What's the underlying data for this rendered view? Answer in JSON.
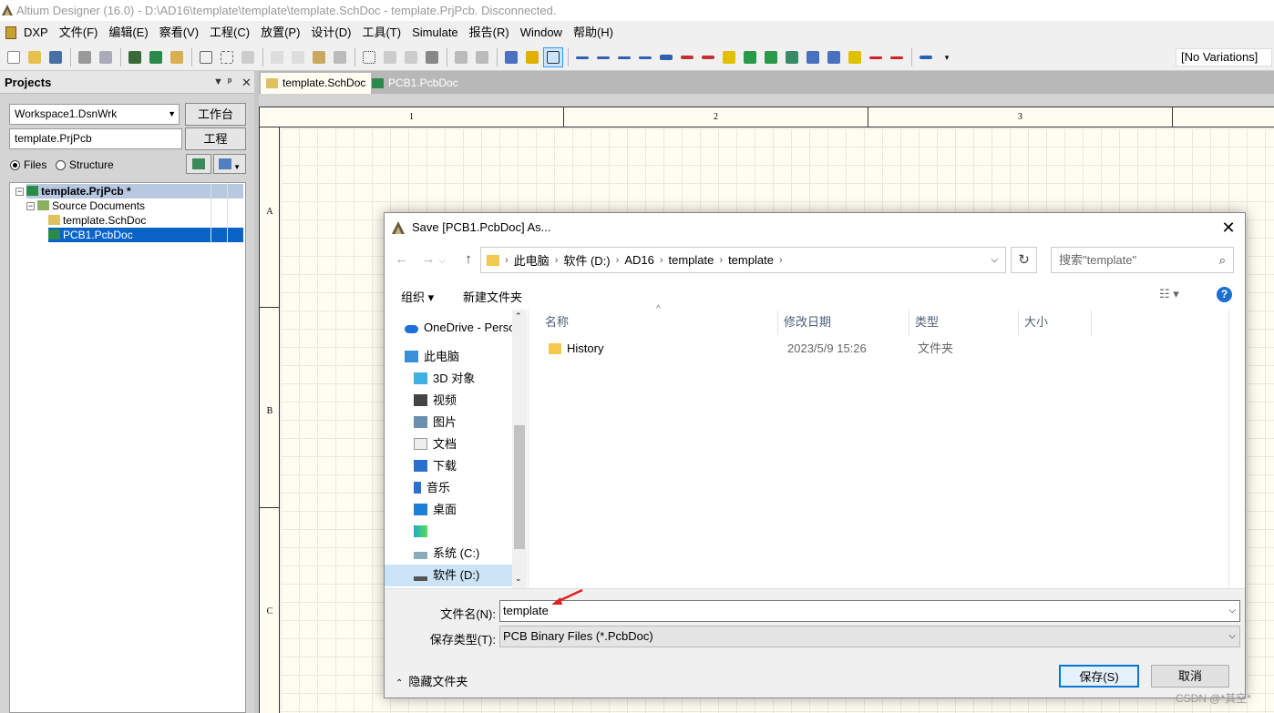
{
  "window": {
    "title": "Altium Designer (16.0) - D:\\AD16\\template\\template\\template.SchDoc - template.PrjPcb. Disconnected."
  },
  "menu": [
    "DXP",
    "文件(F)",
    "编辑(E)",
    "察看(V)",
    "工程(C)",
    "放置(P)",
    "设计(D)",
    "工具(T)",
    "Simulate",
    "报告(R)",
    "Window",
    "帮助(H)"
  ],
  "toolbar": {
    "variations": "[No Variations]"
  },
  "projects": {
    "title": "Projects",
    "workspace": "Workspace1.DsnWrk",
    "workspace_button": "工作台",
    "project": "template.PrjPcb",
    "project_button": "工程",
    "view_files": "Files",
    "view_structure": "Structure",
    "tree": {
      "project": "template.PrjPcb *",
      "folder": "Source Documents",
      "doc1": "template.SchDoc",
      "doc2": "PCB1.PcbDoc"
    }
  },
  "tabs": {
    "t1": "template.SchDoc",
    "t2": "PCB1.PcbDoc"
  },
  "schematic": {
    "cols": [
      "1",
      "2",
      "3"
    ],
    "rows": [
      "A",
      "B",
      "C"
    ]
  },
  "dialog": {
    "title": "Save [PCB1.PcbDoc] As...",
    "path": [
      "此电脑",
      "软件 (D:)",
      "AD16",
      "template",
      "template"
    ],
    "search_placeholder": "搜索\"template\"",
    "organize": "组织 ▾",
    "new_folder": "新建文件夹",
    "nav": {
      "onedrive": "OneDrive - Perso",
      "thispc": "此电脑",
      "objects3d": "3D 对象",
      "video": "视频",
      "pictures": "图片",
      "docs": "文档",
      "downloads": "下载",
      "music": "音乐",
      "desktop": "桌面",
      "sysc": "系统 (C:)",
      "softd": "软件 (D:)"
    },
    "columns": {
      "name": "名称",
      "date": "修改日期",
      "type": "类型",
      "size": "大小"
    },
    "files": [
      {
        "name": "History",
        "date": "2023/5/9 15:26",
        "type": "文件夹",
        "size": ""
      }
    ],
    "filename_label": "文件名(N):",
    "filename_value": "template",
    "filetype_label": "保存类型(T):",
    "filetype_value": "PCB Binary Files (*.PcbDoc)",
    "hide_folders": "隐藏文件夹",
    "save": "保存(S)",
    "cancel": "取消"
  },
  "watermark": "CSDN @*其空*"
}
